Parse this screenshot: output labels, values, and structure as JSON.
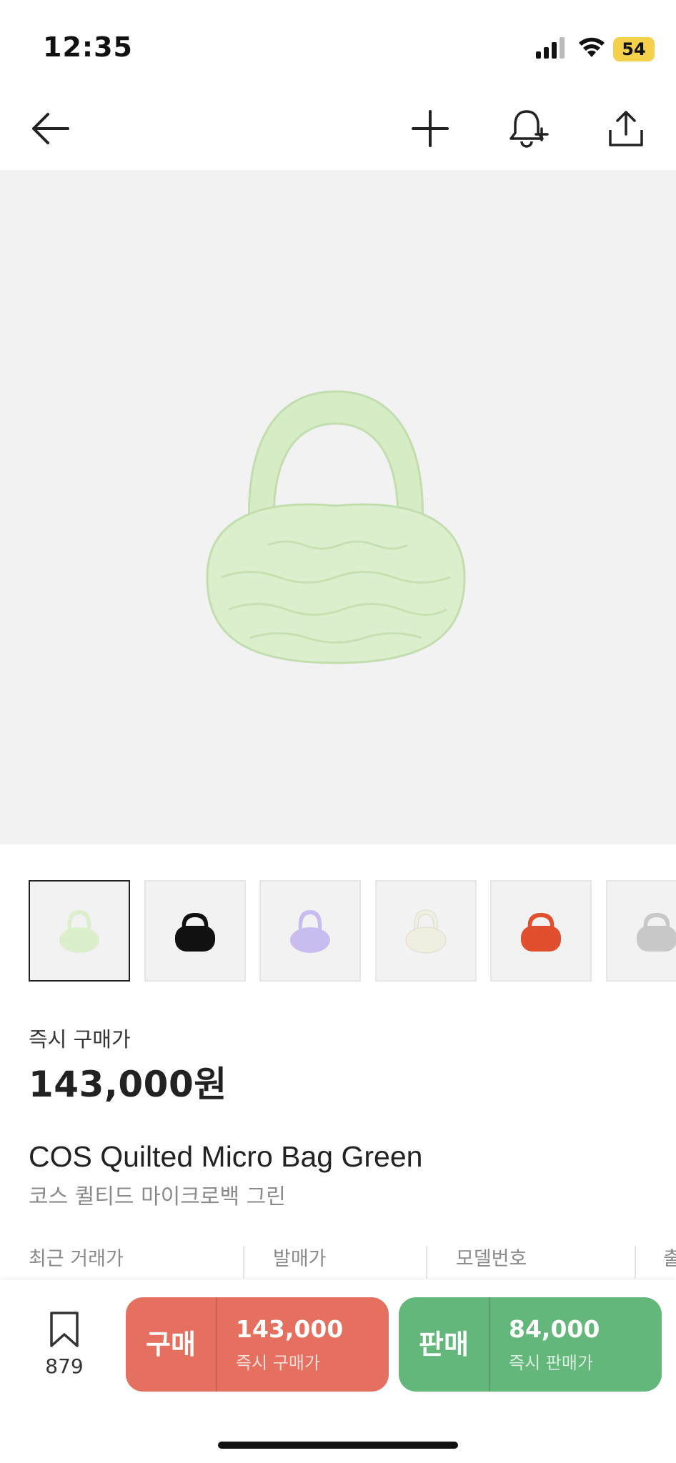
{
  "status_bar": {
    "time": "12:35",
    "battery": "54"
  },
  "nav": {
    "back_icon": "arrow-left-icon",
    "add_icon": "plus-icon",
    "alert_icon": "bell-plus-icon",
    "share_icon": "share-icon"
  },
  "product": {
    "image_color": "#dcefcc",
    "thumbnails": [
      {
        "color": "#dcefcc",
        "active": true
      },
      {
        "color": "#111111",
        "active": false
      },
      {
        "color": "#c9bdf0",
        "active": false
      },
      {
        "color": "#efeee0",
        "active": false
      },
      {
        "color": "#e0502e",
        "active": false
      },
      {
        "color": "#c8c8c8",
        "active": false
      }
    ],
    "price_label": "즉시 구매가",
    "price_value": "143,000원",
    "title_en": "COS Quilted Micro Bag Green",
    "title_ko": "코스 퀼티드 마이크로백 그린"
  },
  "info": {
    "recent_trade": "최근 거래가",
    "release_price": "발매가",
    "model_number": "모델번호",
    "release_date": "출"
  },
  "bottom_bar": {
    "wish_count": "879",
    "buy": {
      "label": "구매",
      "price": "143,000",
      "sub": "즉시 구매가",
      "color": "#e5705f"
    },
    "sell": {
      "label": "판매",
      "price": "84,000",
      "sub": "즉시 판매가",
      "color": "#63b77b"
    }
  }
}
